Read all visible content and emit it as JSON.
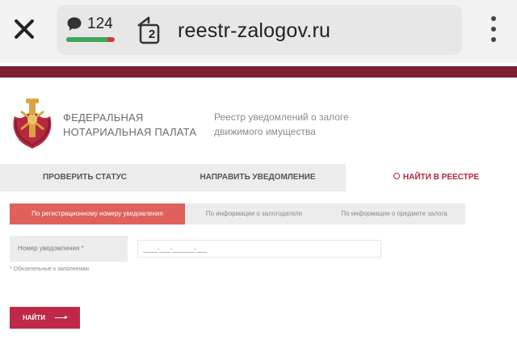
{
  "browser": {
    "comment_count": "124",
    "tabs_count": "2",
    "domain": "reestr-zalogov.ru",
    "comment_score": 0.85,
    "colors": {
      "score_good": "#3ea65a",
      "score_bad": "#d23a3a"
    },
    "icons": {
      "close": "close-icon",
      "comments": "comment-bubble-icon",
      "tabs": "tabs-icon",
      "menu": "kebab-menu-icon"
    }
  },
  "site": {
    "brand_color": "#7a1f34",
    "accent_color": "#c02848",
    "org_name_line1": "ФЕДЕРАЛЬНАЯ",
    "org_name_line2": "НОТАРИАЛЬНАЯ ПАЛАТА",
    "registry_desc_line1": "Реестр уведомлений о залоге",
    "registry_desc_line2": "движимого имущества",
    "logo_icon": "notary-chamber-emblem-icon"
  },
  "nav": {
    "check_status": "ПРОВЕРИТЬ СТАТУС",
    "send_notification": "НАПРАВИТЬ УВЕДОМЛЕНИЕ",
    "find_in_registry": "НАЙТИ В РЕЕСТРЕ"
  },
  "search_tabs": {
    "by_number": "По регистрационному номеру уведомления",
    "by_pledgor": "По информации о залогодателе",
    "by_subject": "По информации о предмете залога"
  },
  "form": {
    "number_label": "Номер уведомления *",
    "number_placeholder": "____-___-______-___",
    "required_note": "* Обязательные к заполнению",
    "submit_label": "НАЙТИ"
  }
}
